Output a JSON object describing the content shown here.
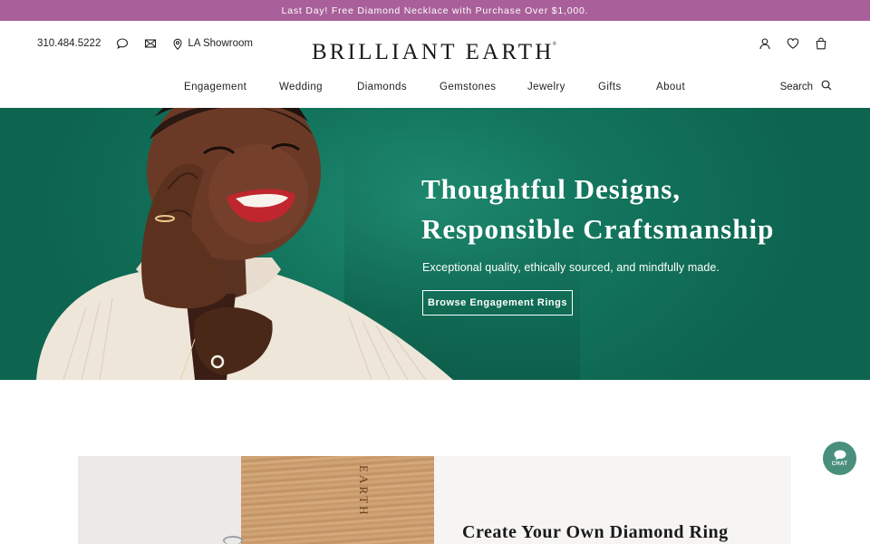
{
  "promo": {
    "text": "Last Day! Free Diamond Necklace with Purchase Over $1,000."
  },
  "header": {
    "phone": "310.484.5222",
    "showroom": "LA Showroom",
    "logo": "BRILLIANT EARTH",
    "logo_mark": "®",
    "icons": [
      "chat-icon",
      "mail-icon",
      "location-pin-icon",
      "account-icon",
      "heart-icon",
      "bag-icon",
      "search-icon"
    ]
  },
  "nav": {
    "items": [
      "Engagement",
      "Wedding",
      "Diamonds",
      "Gemstones",
      "Jewelry",
      "Gifts",
      "About"
    ],
    "search_label": "Search"
  },
  "hero": {
    "title_line1": "Thoughtful Designs,",
    "title_line2": "Responsible Craftsmanship",
    "subtitle": "Exceptional quality, ethically sourced, and mindfully made.",
    "cta": "Browse Engagement Rings",
    "bg_color": "#13755d"
  },
  "promo_card": {
    "title": "Create Your Own Diamond Ring",
    "box_text": "EARTH"
  },
  "chat": {
    "label": "CHAT",
    "color": "#4a8f7c"
  },
  "colors": {
    "promo_bar": "#a9609a",
    "hero_green": "#13755d",
    "chat": "#4a8f7c"
  }
}
